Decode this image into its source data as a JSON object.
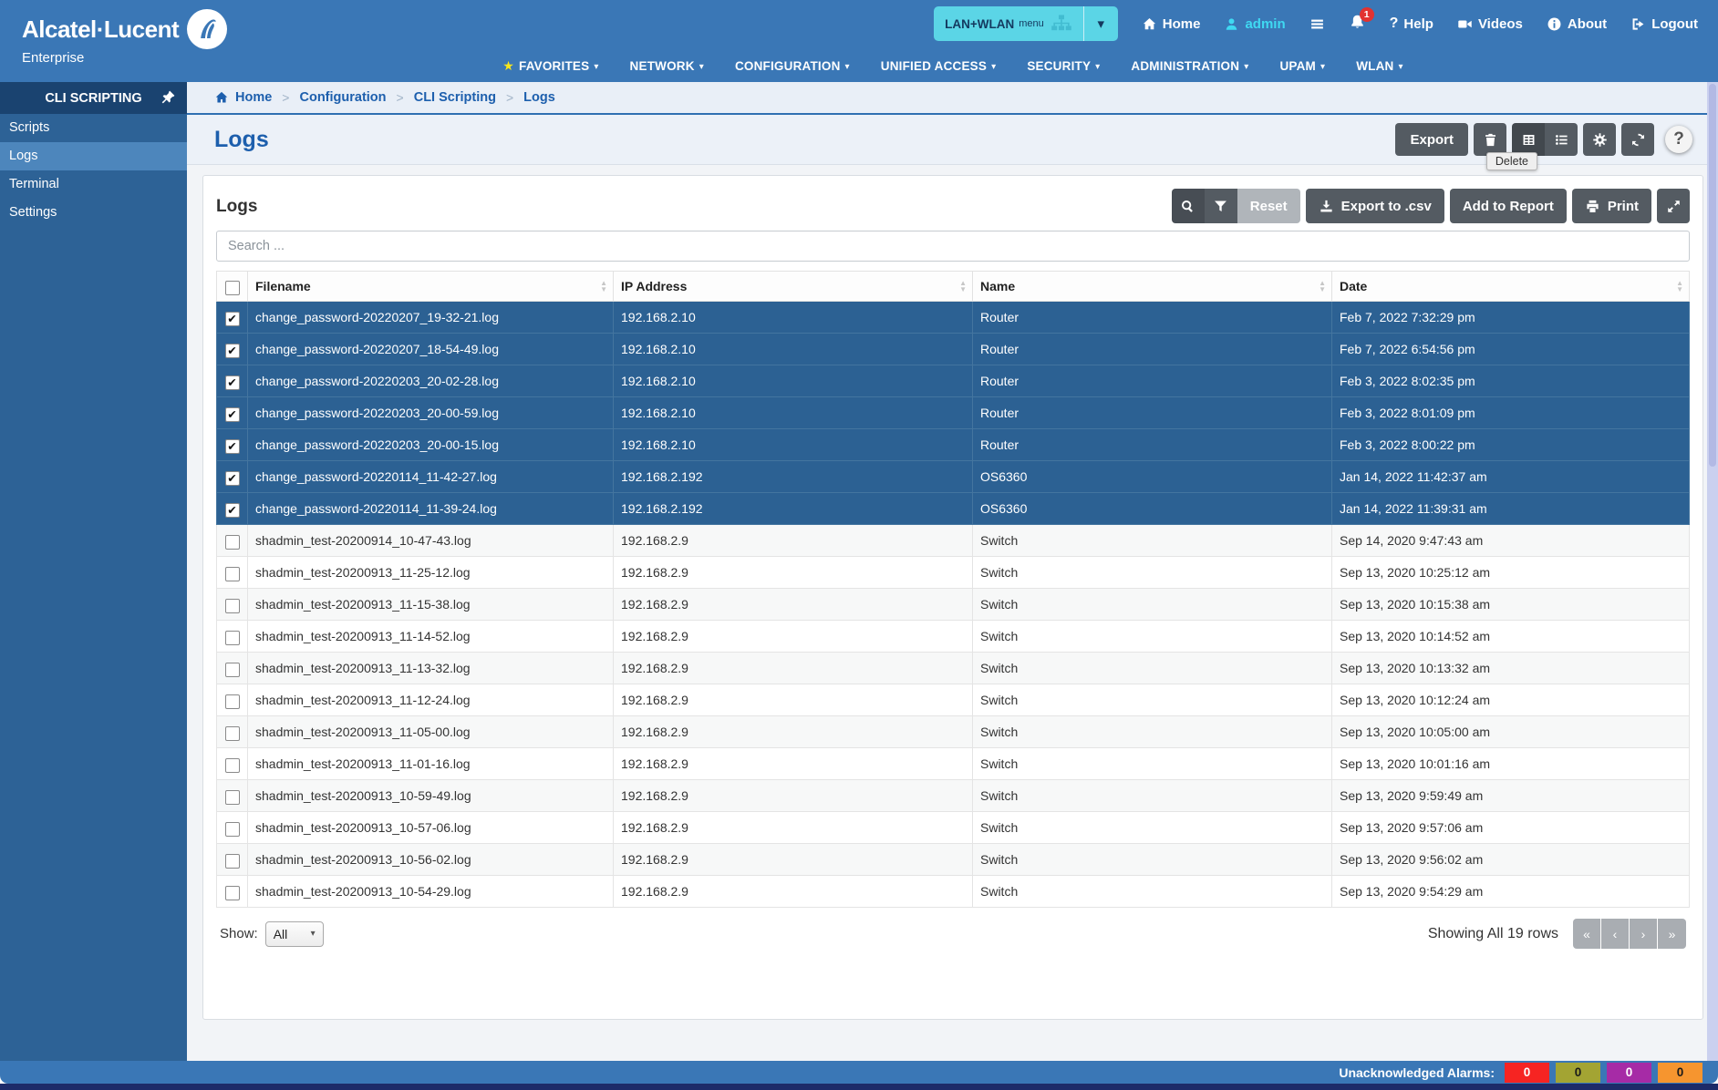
{
  "icons": {
    "question": "?",
    "star": "★",
    "caret_down": "▾",
    "check": "✔",
    "sort_up": "▲",
    "sort_down": "▼",
    "select_caret": "▾",
    "crumb_sep": ">"
  },
  "topbar": {
    "brand": {
      "name": "Alcatel·Lucent",
      "sub": "Enterprise"
    },
    "mode_menu": {
      "label": "LAN+WLAN",
      "suffix": "menu"
    },
    "links": {
      "home": "Home",
      "user": "admin",
      "help": "Help",
      "videos": "Videos",
      "about": "About",
      "logout": "Logout"
    },
    "notification_count": "1"
  },
  "nav": {
    "items": [
      {
        "label": "FAVORITES",
        "starred": true
      },
      {
        "label": "NETWORK"
      },
      {
        "label": "CONFIGURATION"
      },
      {
        "label": "UNIFIED ACCESS"
      },
      {
        "label": "SECURITY"
      },
      {
        "label": "ADMINISTRATION"
      },
      {
        "label": "UPAM"
      },
      {
        "label": "WLAN"
      }
    ]
  },
  "sidebar": {
    "title": "CLI SCRIPTING",
    "items": [
      {
        "label": "Scripts",
        "active": false
      },
      {
        "label": "Logs",
        "active": true
      },
      {
        "label": "Terminal",
        "active": false
      },
      {
        "label": "Settings",
        "active": false
      }
    ]
  },
  "breadcrumb": {
    "items": [
      "Home",
      "Configuration",
      "CLI Scripting",
      "Logs"
    ]
  },
  "page": {
    "title": "Logs",
    "export_label": "Export",
    "delete_tooltip": "Delete"
  },
  "panel": {
    "title": "Logs",
    "search_placeholder": "Search ...",
    "toolbar": {
      "reset": "Reset",
      "export_csv": "Export to .csv",
      "add_to_report": "Add to Report",
      "print": "Print"
    }
  },
  "table": {
    "columns": [
      "Filename",
      "IP Address",
      "Name",
      "Date"
    ],
    "rows": [
      {
        "filename": "change_password-20220207_19-32-21.log",
        "ip": "192.168.2.10",
        "name": "Router",
        "date": "Feb 7, 2022 7:32:29 pm",
        "selected": true
      },
      {
        "filename": "change_password-20220207_18-54-49.log",
        "ip": "192.168.2.10",
        "name": "Router",
        "date": "Feb 7, 2022 6:54:56 pm",
        "selected": true
      },
      {
        "filename": "change_password-20220203_20-02-28.log",
        "ip": "192.168.2.10",
        "name": "Router",
        "date": "Feb 3, 2022 8:02:35 pm",
        "selected": true
      },
      {
        "filename": "change_password-20220203_20-00-59.log",
        "ip": "192.168.2.10",
        "name": "Router",
        "date": "Feb 3, 2022 8:01:09 pm",
        "selected": true
      },
      {
        "filename": "change_password-20220203_20-00-15.log",
        "ip": "192.168.2.10",
        "name": "Router",
        "date": "Feb 3, 2022 8:00:22 pm",
        "selected": true
      },
      {
        "filename": "change_password-20220114_11-42-27.log",
        "ip": "192.168.2.192",
        "name": "OS6360",
        "date": "Jan 14, 2022 11:42:37 am",
        "selected": true
      },
      {
        "filename": "change_password-20220114_11-39-24.log",
        "ip": "192.168.2.192",
        "name": "OS6360",
        "date": "Jan 14, 2022 11:39:31 am",
        "selected": true
      },
      {
        "filename": "shadmin_test-20200914_10-47-43.log",
        "ip": "192.168.2.9",
        "name": "Switch",
        "date": "Sep 14, 2020 9:47:43 am",
        "selected": false
      },
      {
        "filename": "shadmin_test-20200913_11-25-12.log",
        "ip": "192.168.2.9",
        "name": "Switch",
        "date": "Sep 13, 2020 10:25:12 am",
        "selected": false
      },
      {
        "filename": "shadmin_test-20200913_11-15-38.log",
        "ip": "192.168.2.9",
        "name": "Switch",
        "date": "Sep 13, 2020 10:15:38 am",
        "selected": false
      },
      {
        "filename": "shadmin_test-20200913_11-14-52.log",
        "ip": "192.168.2.9",
        "name": "Switch",
        "date": "Sep 13, 2020 10:14:52 am",
        "selected": false
      },
      {
        "filename": "shadmin_test-20200913_11-13-32.log",
        "ip": "192.168.2.9",
        "name": "Switch",
        "date": "Sep 13, 2020 10:13:32 am",
        "selected": false
      },
      {
        "filename": "shadmin_test-20200913_11-12-24.log",
        "ip": "192.168.2.9",
        "name": "Switch",
        "date": "Sep 13, 2020 10:12:24 am",
        "selected": false
      },
      {
        "filename": "shadmin_test-20200913_11-05-00.log",
        "ip": "192.168.2.9",
        "name": "Switch",
        "date": "Sep 13, 2020 10:05:00 am",
        "selected": false
      },
      {
        "filename": "shadmin_test-20200913_11-01-16.log",
        "ip": "192.168.2.9",
        "name": "Switch",
        "date": "Sep 13, 2020 10:01:16 am",
        "selected": false
      },
      {
        "filename": "shadmin_test-20200913_10-59-49.log",
        "ip": "192.168.2.9",
        "name": "Switch",
        "date": "Sep 13, 2020 9:59:49 am",
        "selected": false
      },
      {
        "filename": "shadmin_test-20200913_10-57-06.log",
        "ip": "192.168.2.9",
        "name": "Switch",
        "date": "Sep 13, 2020 9:57:06 am",
        "selected": false
      },
      {
        "filename": "shadmin_test-20200913_10-56-02.log",
        "ip": "192.168.2.9",
        "name": "Switch",
        "date": "Sep 13, 2020 9:56:02 am",
        "selected": false
      },
      {
        "filename": "shadmin_test-20200913_10-54-29.log",
        "ip": "192.168.2.9",
        "name": "Switch",
        "date": "Sep 13, 2020 9:54:29 am",
        "selected": false
      }
    ]
  },
  "pager": {
    "show_label": "Show:",
    "show_value": "All",
    "summary": "Showing All 19 rows",
    "buttons": [
      {
        "name": "first",
        "glyph": "«"
      },
      {
        "name": "prev",
        "glyph": "‹"
      },
      {
        "name": "next",
        "glyph": "›"
      },
      {
        "name": "last",
        "glyph": "»"
      }
    ]
  },
  "alarm_bar": {
    "label": "Unacknowledged Alarms:",
    "badges": [
      {
        "value": "0",
        "bg": "#f62422",
        "fg": "#ffffff",
        "severity": "critical"
      },
      {
        "value": "0",
        "bg": "#a3a433",
        "fg": "#1a1a1a",
        "severity": "major"
      },
      {
        "value": "0",
        "bg": "#a62ba6",
        "fg": "#ffffff",
        "severity": "minor"
      },
      {
        "value": "0",
        "bg": "#f6952f",
        "fg": "#1a1a1a",
        "severity": "warning"
      }
    ]
  }
}
